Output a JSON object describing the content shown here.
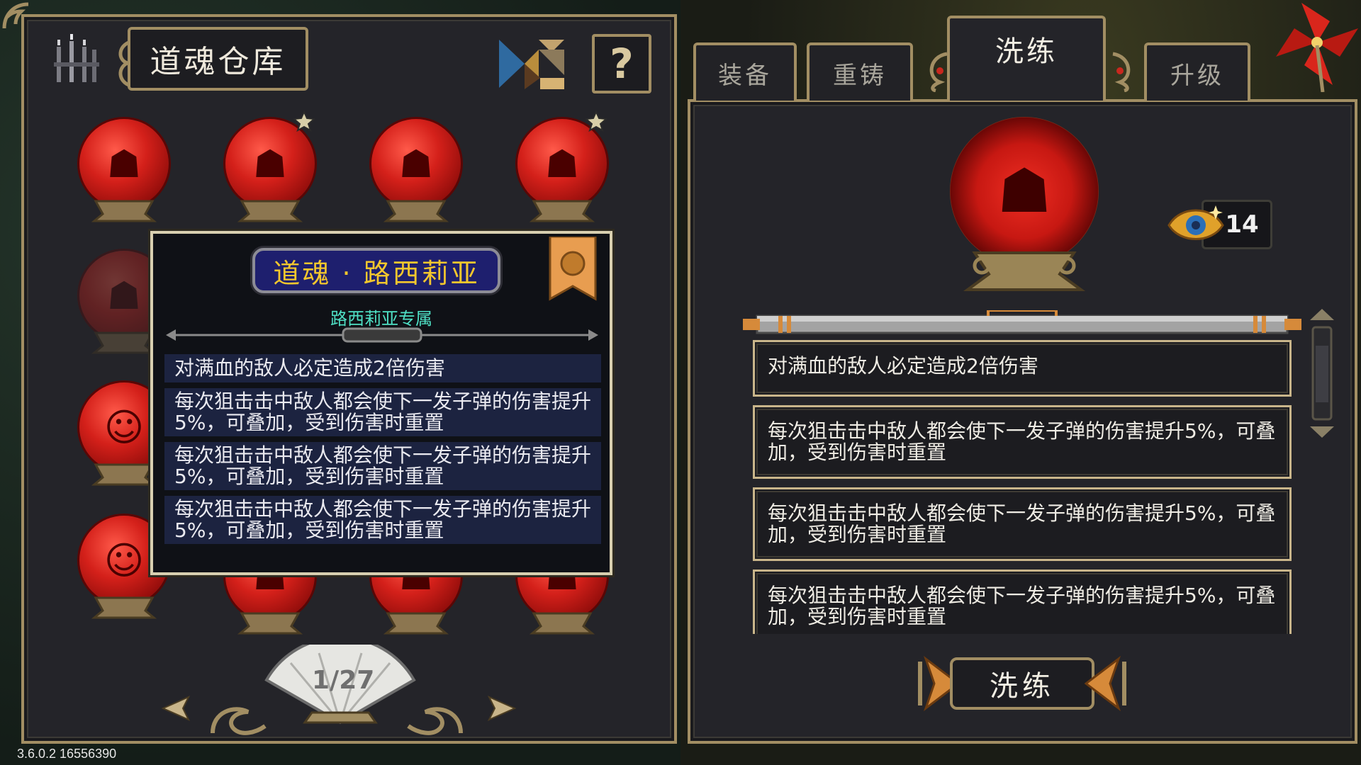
{
  "left_panel": {
    "title": "道魂仓库",
    "help_label": "?"
  },
  "tooltip": {
    "name": "道魂 · 路西莉亚",
    "subtitle": "路西莉亚专属",
    "lines": [
      "对满血的敌人必定造成2倍伤害",
      "每次狙击击中敌人都会使下一发子弹的伤害提升5%，可叠加，受到伤害时重置",
      "每次狙击击中敌人都会使下一发子弹的伤害提升5%，可叠加，受到伤害时重置",
      "每次狙击击中敌人都会使下一发子弹的伤害提升5%，可叠加，受到伤害时重置"
    ]
  },
  "pager": {
    "text": "1/27"
  },
  "version": "3.6.0.2 16556390",
  "tabs": [
    {
      "label": "装备",
      "active": false
    },
    {
      "label": "重铸",
      "active": false
    },
    {
      "label": "洗练",
      "active": true
    },
    {
      "label": "升级",
      "active": false
    }
  ],
  "currency": {
    "amount": "14"
  },
  "affixes": [
    "对满血的敌人必定造成2倍伤害",
    "每次狙击击中敌人都会使下一发子弹的伤害提升5%，可叠加，受到伤害时重置",
    "每次狙击击中敌人都会使下一发子弹的伤害提升5%，可叠加，受到伤害时重置",
    "每次狙击击中敌人都会使下一发子弹的伤害提升5%，可叠加，受到伤害时重置"
  ],
  "reroll_button": {
    "label": "洗练"
  },
  "colors": {
    "frame_gold": "#a28e63",
    "orb_red": "#d4201a",
    "tooltip_name": "#f4c72d",
    "tooltip_subtitle": "#4fe0c5",
    "name_plate_bg": "#1e1f6e"
  },
  "icons": {
    "soul_orb": "mask-glyph-icon",
    "star": "star-icon",
    "help": "question-icon",
    "currency": "eye-gem-icon"
  }
}
